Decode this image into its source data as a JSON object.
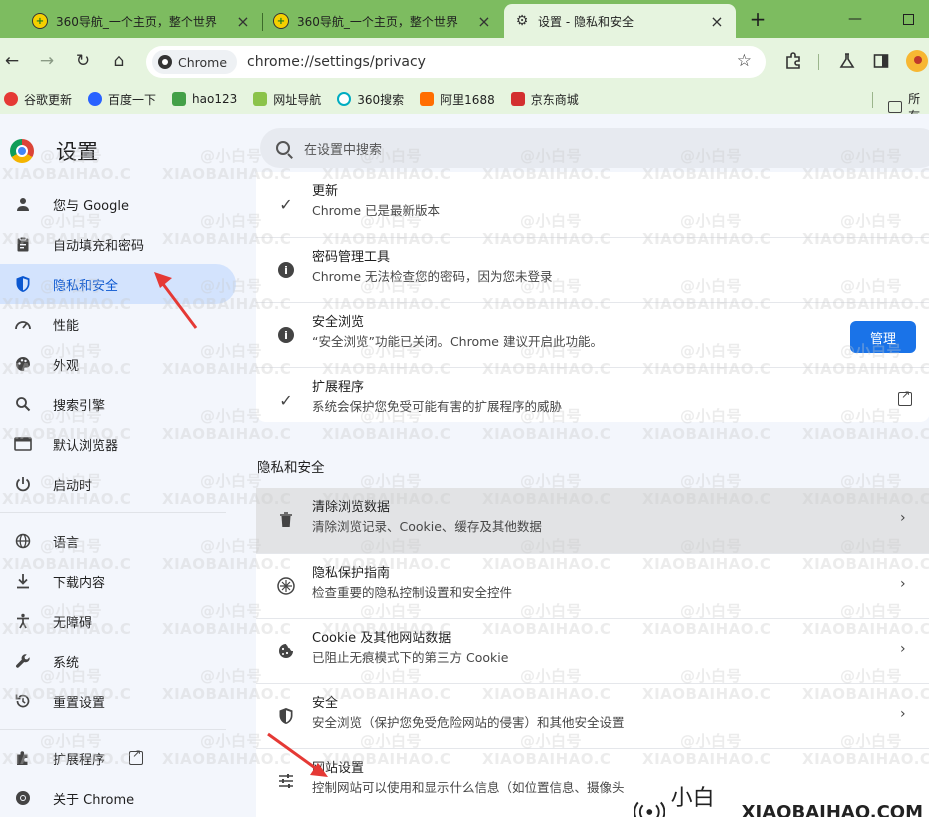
{
  "tabs": [
    {
      "title": "360导航_一个主页，整个世界"
    },
    {
      "title": "360导航_一个主页，整个世界"
    },
    {
      "title": "设置 - 隐私和安全"
    }
  ],
  "toolbar": {
    "chip_label": "Chrome",
    "url": "chrome://settings/privacy"
  },
  "bookmarks": [
    {
      "label": "谷歌更新",
      "color": "#e53935"
    },
    {
      "label": "百度一下",
      "color": "#2962ff"
    },
    {
      "label": "hao123",
      "color": "#43a047"
    },
    {
      "label": "网址导航",
      "color": "#8bc34a"
    },
    {
      "label": "360搜索",
      "color": "#00acc1"
    },
    {
      "label": "阿里1688",
      "color": "#ff6d00"
    },
    {
      "label": "京东商城",
      "color": "#d32f2f"
    }
  ],
  "bookmark_folder": "所有",
  "settings": {
    "title": "设置",
    "search_placeholder": "在设置中搜索"
  },
  "nav": [
    {
      "label": "您与 Google",
      "icon": "person-icon"
    },
    {
      "label": "自动填充和密码",
      "icon": "clipboard-icon"
    },
    {
      "label": "隐私和安全",
      "icon": "shield-icon",
      "selected": true
    },
    {
      "label": "性能",
      "icon": "gauge-icon"
    },
    {
      "label": "外观",
      "icon": "palette-icon"
    },
    {
      "label": "搜索引擎",
      "icon": "search-icon"
    },
    {
      "label": "默认浏览器",
      "icon": "browser-icon"
    },
    {
      "label": "启动时",
      "icon": "power-icon"
    }
  ],
  "nav2": [
    {
      "label": "语言",
      "icon": "globe-icon"
    },
    {
      "label": "下载内容",
      "icon": "download-icon"
    },
    {
      "label": "无障碍",
      "icon": "accessibility-icon"
    },
    {
      "label": "系统",
      "icon": "wrench-icon"
    },
    {
      "label": "重置设置",
      "icon": "reset-icon"
    }
  ],
  "nav3": [
    {
      "label": "扩展程序",
      "icon": "puzzle-icon"
    },
    {
      "label": "关于 Chrome",
      "icon": "chrome-icon"
    }
  ],
  "safety_check": [
    {
      "title": "更新",
      "subtitle": "Chrome 已是最新版本",
      "icon": "check-icon"
    },
    {
      "title": "密码管理工具",
      "subtitle": "Chrome 无法检查您的密码，因为您未登录",
      "icon": "info-icon"
    },
    {
      "title": "安全浏览",
      "subtitle": "“安全浏览”功能已关闭。Chrome 建议开启此功能。",
      "icon": "info-icon",
      "button": "管理"
    },
    {
      "title": "扩展程序",
      "subtitle": "系统会保护您免受可能有害的扩展程序的威胁",
      "icon": "check-icon"
    }
  ],
  "privacy_section": {
    "title": "隐私和安全",
    "rows": [
      {
        "title": "清除浏览数据",
        "subtitle": "清除浏览记录、Cookie、缓存及其他数据",
        "icon": "trash-icon"
      },
      {
        "title": "隐私保护指南",
        "subtitle": "检查重要的隐私控制设置和安全控件",
        "icon": "guide-icon"
      },
      {
        "title": "Cookie 及其他网站数据",
        "subtitle": "已阻止无痕模式下的第三方 Cookie",
        "icon": "cookie-icon"
      },
      {
        "title": "安全",
        "subtitle": "安全浏览（保护您免受危险网站的侵害）和其他安全设置",
        "icon": "shield-icon"
      },
      {
        "title": "网站设置",
        "subtitle": "控制网站可以使用和显示什么信息（如位置信息、摄像头",
        "icon": "sliders-icon"
      }
    ]
  },
  "watermark": {
    "handle": "@小白号",
    "domain": "XIAOBAIHAO.COM",
    "brand_cn": "小白号",
    "brand_en": "XIAOBAIHAO.COM"
  },
  "colors": {
    "tabstrip": "#7dbc60",
    "toolbar": "#e6f4df",
    "accent": "#0b57d0",
    "primary_button": "#1a73e8",
    "annotation_arrow": "#e53935"
  }
}
